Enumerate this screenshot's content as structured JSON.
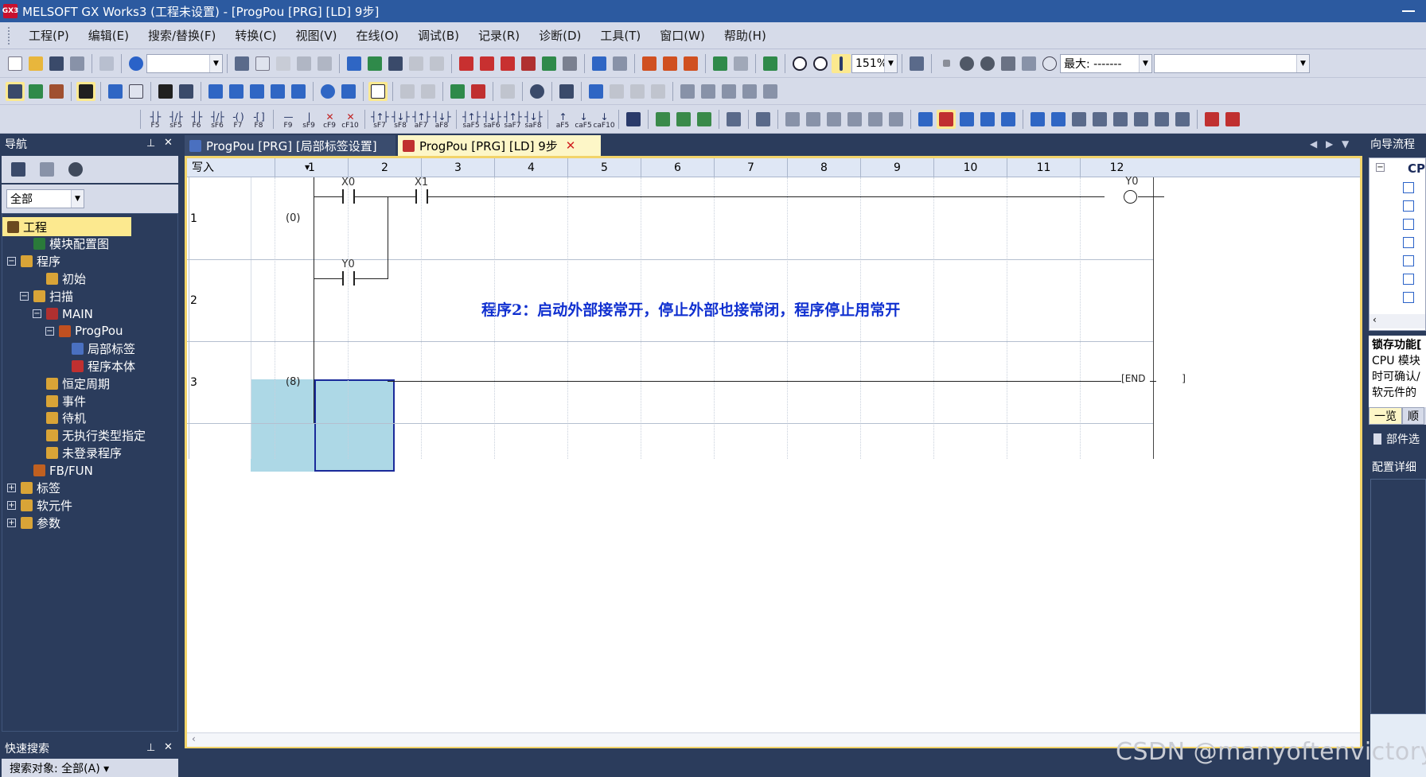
{
  "window": {
    "title": "MELSOFT GX Works3 (工程未设置) - [ProgPou [PRG] [LD] 9步]",
    "logo": "GX3"
  },
  "menu": [
    "工程(P)",
    "编辑(E)",
    "搜索/替换(F)",
    "转换(C)",
    "视图(V)",
    "在线(O)",
    "调试(B)",
    "记录(R)",
    "诊断(D)",
    "工具(T)",
    "窗口(W)",
    "帮助(H)"
  ],
  "toolbar": {
    "zoom": "151%",
    "max_label": "最大: -------"
  },
  "fkeys": [
    {
      "glyph": "┤├",
      "key": "F5"
    },
    {
      "glyph": "┤/├",
      "key": "sF5"
    },
    {
      "glyph": "┤├",
      "key": "F6"
    },
    {
      "glyph": "┤/├",
      "key": "sF6"
    },
    {
      "glyph": "-( )",
      "key": "F7"
    },
    {
      "glyph": "-[ ]",
      "key": "F8"
    },
    {
      "glyph": "—",
      "key": "F9"
    },
    {
      "glyph": "|",
      "key": "sF9"
    },
    {
      "glyph": "✕",
      "key": "cF9"
    },
    {
      "glyph": "✕",
      "key": "cF10"
    },
    {
      "glyph": "┤↑├",
      "key": "sF7"
    },
    {
      "glyph": "┤↓├",
      "key": "sF8"
    },
    {
      "glyph": "┤↑├",
      "key": "aF7"
    },
    {
      "glyph": "┤↓├",
      "key": "aF8"
    },
    {
      "glyph": "┤↑├",
      "key": "saF5"
    },
    {
      "glyph": "┤↓├",
      "key": "saF6"
    },
    {
      "glyph": "┤↑├",
      "key": "saF7"
    },
    {
      "glyph": "┤↓├",
      "key": "saF8"
    },
    {
      "glyph": "↑",
      "key": "aF5"
    },
    {
      "glyph": "↓",
      "key": "caF5"
    },
    {
      "glyph": "↓",
      "key": "caF10"
    }
  ],
  "navigation": {
    "title": "导航",
    "filter": "全部",
    "tree": [
      {
        "label": "工程",
        "depth": 0,
        "expander": "",
        "selected": true,
        "icon": "#6b4a1f"
      },
      {
        "label": "模块配置图",
        "depth": 1,
        "expander": "",
        "icon": "#2a7a3a"
      },
      {
        "label": "程序",
        "depth": 0,
        "expander": "−",
        "icon": "#d9a437"
      },
      {
        "label": "初始",
        "depth": 2,
        "expander": "",
        "icon": "#d9a437"
      },
      {
        "label": "扫描",
        "depth": 1,
        "expander": "−",
        "icon": "#d9a437"
      },
      {
        "label": "MAIN",
        "depth": 2,
        "expander": "−",
        "icon": "#b03030"
      },
      {
        "label": "ProgPou",
        "depth": 3,
        "expander": "−",
        "icon": "#c05020"
      },
      {
        "label": "局部标签",
        "depth": 4,
        "expander": "",
        "icon": "#4a70c0"
      },
      {
        "label": "程序本体",
        "depth": 4,
        "expander": "",
        "icon": "#c03030"
      },
      {
        "label": "恒定周期",
        "depth": 2,
        "expander": "",
        "icon": "#d9a437"
      },
      {
        "label": "事件",
        "depth": 2,
        "expander": "",
        "icon": "#d9a437"
      },
      {
        "label": "待机",
        "depth": 2,
        "expander": "",
        "icon": "#d9a437"
      },
      {
        "label": "无执行类型指定",
        "depth": 2,
        "expander": "",
        "icon": "#d9a437"
      },
      {
        "label": "未登录程序",
        "depth": 2,
        "expander": "",
        "icon": "#d9a437"
      },
      {
        "label": "FB/FUN",
        "depth": 1,
        "expander": "",
        "icon": "#c06020"
      },
      {
        "label": "标签",
        "depth": 0,
        "expander": "+",
        "icon": "#d9a437"
      },
      {
        "label": "软元件",
        "depth": 0,
        "expander": "+",
        "icon": "#d9a437"
      },
      {
        "label": "参数",
        "depth": 0,
        "expander": "+",
        "icon": "#d9a437"
      }
    ]
  },
  "quick_search": {
    "title": "快速搜索",
    "target": "搜索对象: 全部(A) ▾"
  },
  "tabs": [
    {
      "label": "ProgPou [PRG] [局部标签设置]",
      "active": false
    },
    {
      "label": "ProgPou [PRG] [LD] 9步",
      "active": true
    }
  ],
  "ladder": {
    "mode": "写入",
    "columns": [
      "1",
      "2",
      "3",
      "4",
      "5",
      "6",
      "7",
      "8",
      "9",
      "10",
      "11",
      "12"
    ],
    "rows": [
      {
        "num": "1",
        "step": "(0)"
      },
      {
        "num": "2",
        "step": ""
      },
      {
        "num": "3",
        "step": "(8)"
      }
    ],
    "contacts": [
      {
        "device": "X0",
        "type": "NO"
      },
      {
        "device": "X1",
        "type": "NO"
      },
      {
        "device": "Y0",
        "type": "NO"
      }
    ],
    "coil": "Y0",
    "end": "END",
    "comment": "程序2：启动外部接常开，停止外部也接常闭，程序停止用常开"
  },
  "wizard": {
    "title": "向导流程",
    "root": "CPU",
    "heading": "锁存功能[",
    "text": [
      "CPU 模块",
      "时可确认/",
      "软元件的"
    ],
    "tabs": [
      "一览",
      "顺"
    ],
    "parts": "部件选",
    "config": "配置详细"
  },
  "watermark": "CSDN @manyoftenvictory"
}
